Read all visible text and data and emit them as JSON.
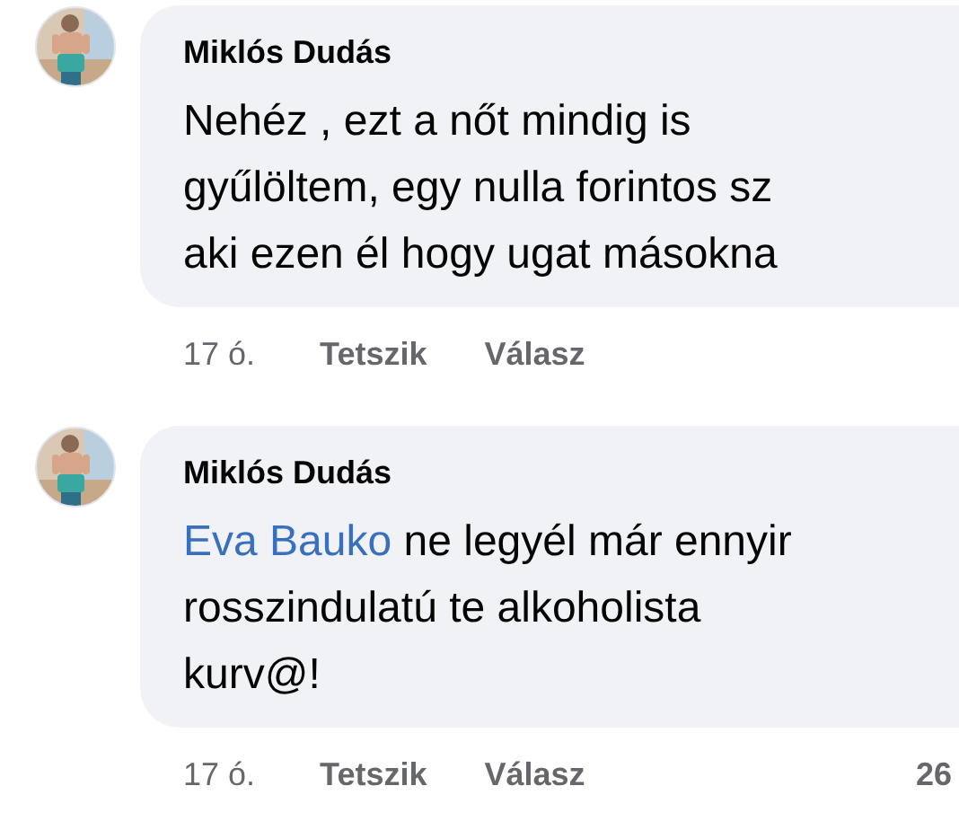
{
  "comments": [
    {
      "author": "Miklós Dudás",
      "lines": [
        "Nehéz , ezt a nőt mindig is",
        "gyűlöltem, egy nulla forintos sz",
        "aki ezen él hogy ugat másokna"
      ],
      "time": "17 ó.",
      "like": "Tetszik",
      "reply": "Válasz"
    },
    {
      "author": "Miklós Dudás",
      "mention": "Eva Bauko",
      "lines": [
        "ne legyél már ennyir",
        "rosszindulatú te alkoholista",
        "kurv@!"
      ],
      "time": "17 ó.",
      "like": "Tetszik",
      "reply": "Válasz",
      "reaction_count": "26"
    }
  ]
}
